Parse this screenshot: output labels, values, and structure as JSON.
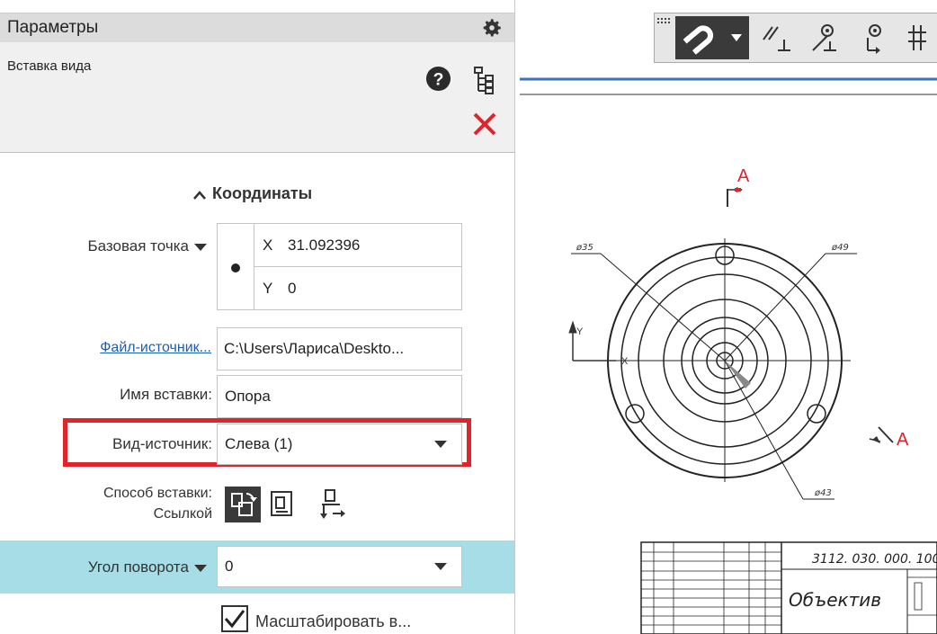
{
  "panel": {
    "title": "Параметры",
    "command": "Вставка вида"
  },
  "coords": {
    "section": "Координаты",
    "base_point_label": "Базовая точка",
    "x_label": "X",
    "x_value": "31.092396",
    "y_label": "Y",
    "y_value": "0"
  },
  "source_file": {
    "label": "Файл-источник...",
    "value": "C:\\Users\\Лариса\\Deskto..."
  },
  "insert_name": {
    "label": "Имя вставки:",
    "value": "Опора"
  },
  "source_view": {
    "label": "Вид-источник:",
    "value": "Слева (1)"
  },
  "insert_method": {
    "label": "Способ вставки:",
    "value": "Ссылкой"
  },
  "rotation": {
    "label": "Угол поворота",
    "value": "0"
  },
  "scale_checkbox": {
    "label": "Масштабировать в...",
    "checked": true
  },
  "drawing": {
    "section_letter_top": "A",
    "section_letter_right": "A",
    "dim_35": "ø35",
    "dim_49": "ø49",
    "dim_43": "ø43",
    "axis_x": "X",
    "axis_y": "Y",
    "stamp_code": "3112. 030. 000. 100",
    "stamp_name": "Объектив"
  },
  "colors": {
    "highlight_box": "#e0242c",
    "close_icon": "#e0242c",
    "angle_band": "#a6dde6",
    "section_marks": "#e0242c",
    "frame_line": "#3b6fbf"
  },
  "icons": [
    "gear-icon",
    "help-icon",
    "tree-icon",
    "close-icon",
    "caret-up-icon",
    "dropdown-icon",
    "magnet-icon",
    "parallel-icon",
    "perpendicular-icon",
    "snap-icon"
  ]
}
